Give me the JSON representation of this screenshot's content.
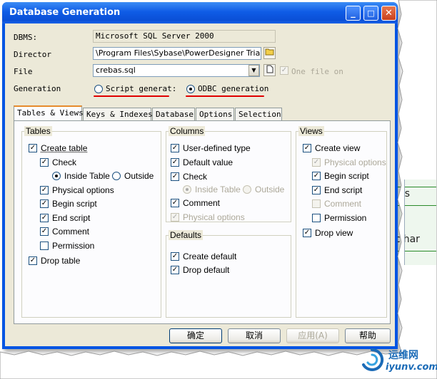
{
  "window": {
    "title": "Database Generation",
    "minimize": "_",
    "maximize": "□",
    "close": "✕"
  },
  "form": {
    "dbms_label": "DBMS:",
    "dbms_value": "Microsoft SQL Server 2000",
    "director_label": "Director",
    "director_value": "\\Program Files\\Sybase\\PowerDesigner Trial 11\\",
    "file_label": "File",
    "file_value": "crebas.sql",
    "one_file_label": "One file on",
    "generation_label": "Generation",
    "script_label": "Script generat:",
    "odbc_label": "ODBC generation"
  },
  "tabs": [
    "Tables & Views",
    "Keys & Indexes",
    "Database",
    "Options",
    "Selection"
  ],
  "tables": {
    "title": "Tables",
    "create_table": "Create table",
    "check": "Check",
    "inside_table": "Inside Table",
    "outside": "Outside",
    "physical_options": "Physical options",
    "begin_script": "Begin script",
    "end_script": "End script",
    "comment": "Comment",
    "permission": "Permission",
    "drop_table": "Drop table"
  },
  "columns": {
    "title": "Columns",
    "user_defined_type": "User-defined type",
    "default_value": "Default value",
    "check": "Check",
    "inside_table": "Inside Table",
    "outside": "Outside",
    "comment": "Comment",
    "physical_options": "Physical options"
  },
  "defaults": {
    "title": "Defaults",
    "create_default": "Create default",
    "drop_default": "Drop default"
  },
  "views": {
    "title": "Views",
    "create_view": "Create view",
    "physical_options": "Physical options",
    "begin_script": "Begin script",
    "end_script": "End script",
    "comment": "Comment",
    "permission": "Permission",
    "drop_view": "Drop view"
  },
  "buttons": {
    "ok": "确定",
    "cancel": "取消",
    "apply": "应用(A)",
    "help": "帮助"
  },
  "background": {
    "text1": "rs",
    "text2": "char"
  },
  "watermark": {
    "cn": "运维网",
    "url": "iyunv.com"
  },
  "colors": {
    "titlebar": "#0a4fd6",
    "dialog": "#ece9d8",
    "annotation": "#e00000",
    "tab_accent": "#e68b2c"
  }
}
